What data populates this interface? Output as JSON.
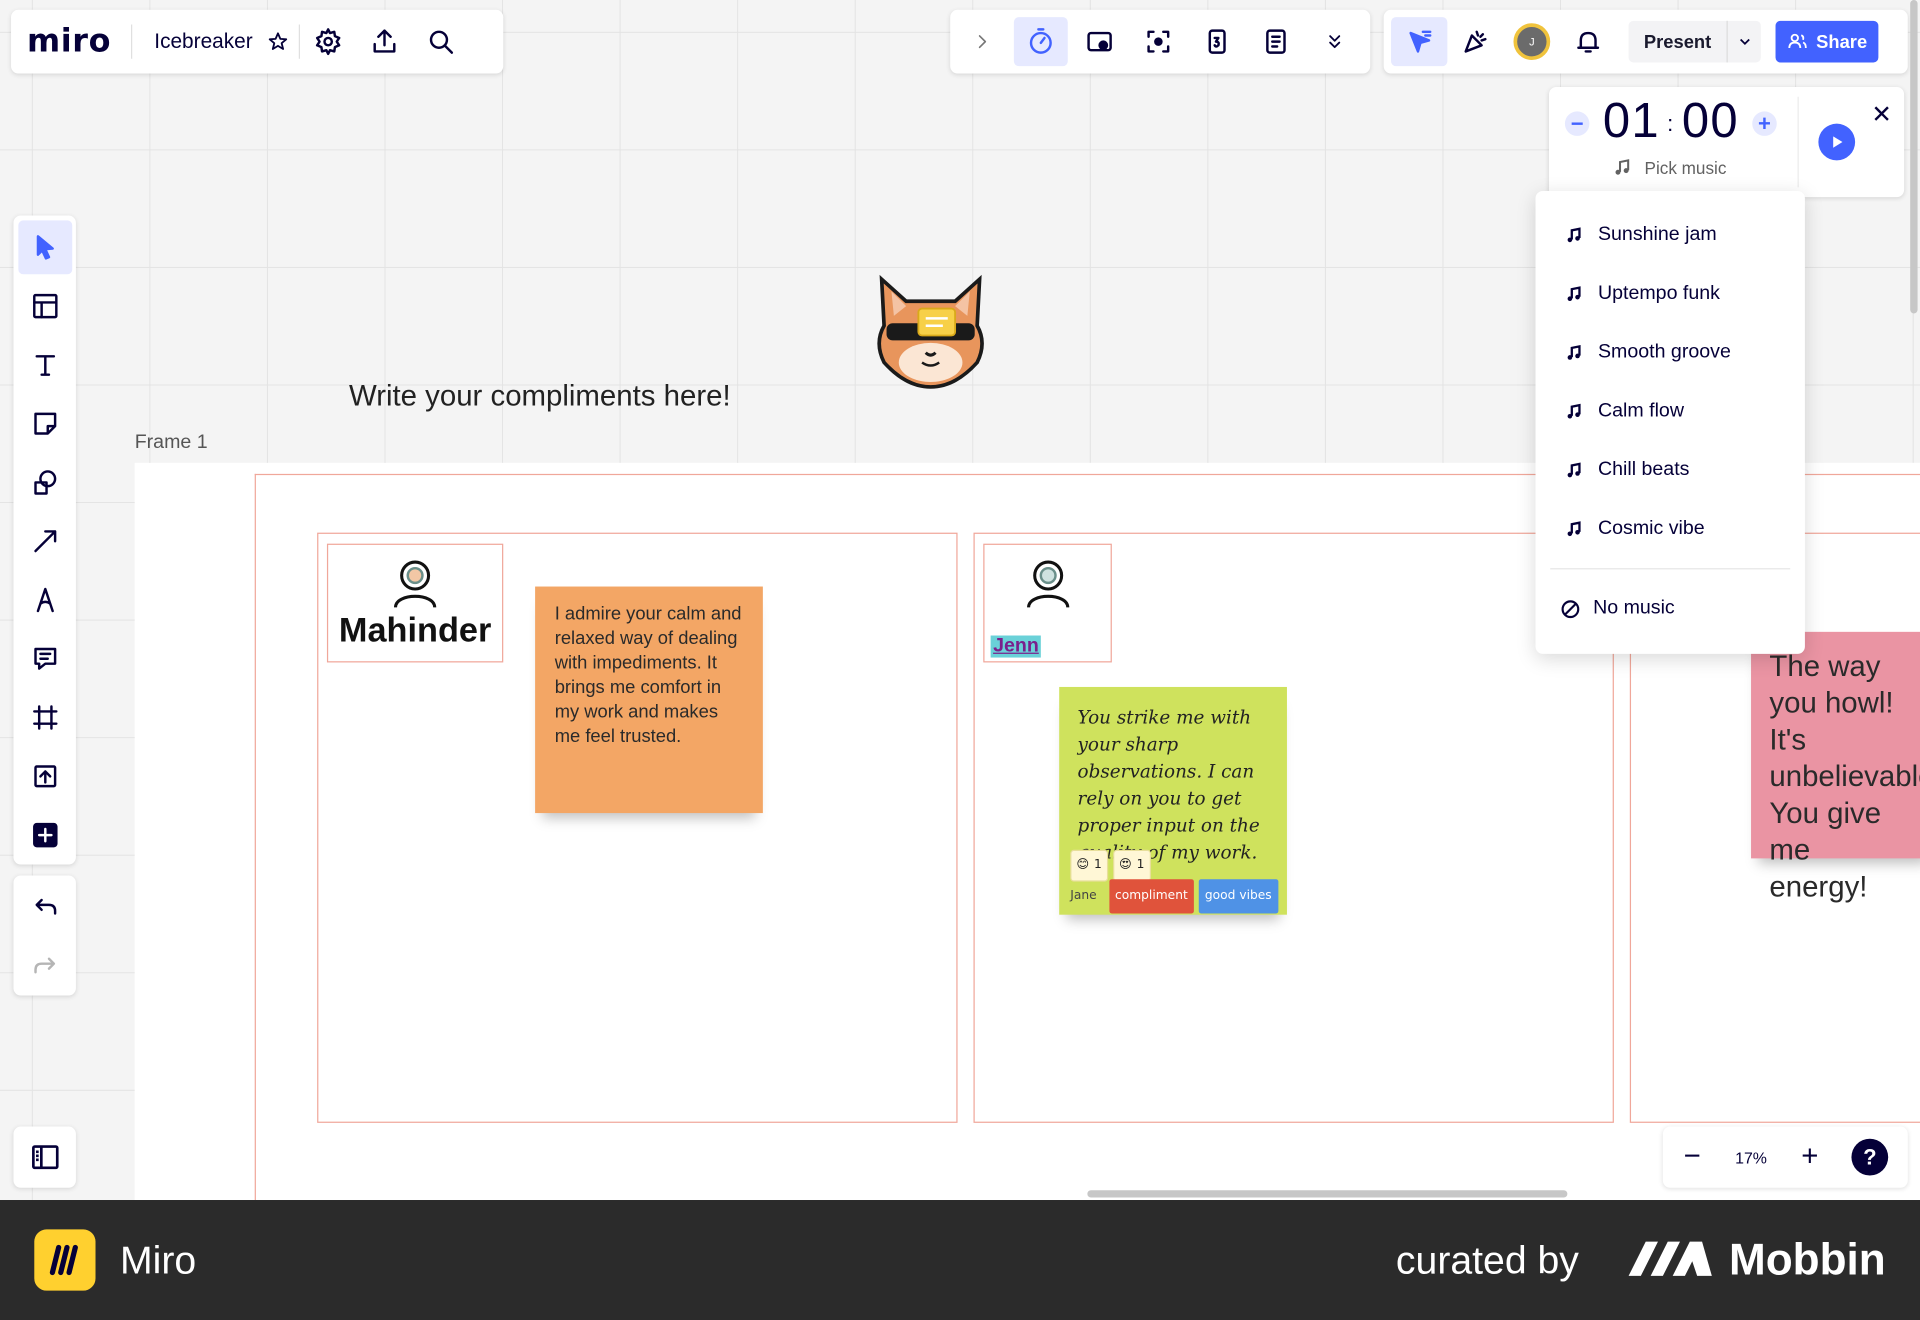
{
  "app": {
    "logo": "miro",
    "board_name": "Icebreaker"
  },
  "toolbar_right": {
    "avatar_initial": "J",
    "present_label": "Present",
    "share_label": "Share"
  },
  "timer": {
    "minutes": "01",
    "seconds": "00",
    "separator": ":",
    "minus": "−",
    "plus": "+",
    "pick_music": "Pick music",
    "close": "✕"
  },
  "music_menu": {
    "items": [
      "Sunshine jam",
      "Uptempo funk",
      "Smooth groove",
      "Calm flow",
      "Chill beats",
      "Cosmic vibe"
    ],
    "none_label": "No music"
  },
  "canvas": {
    "heading": "Write your compliments here!",
    "frame_label": "Frame 1",
    "people": [
      "Mahinder",
      "Jenn"
    ],
    "stickies": {
      "orange": "I admire your calm and relaxed way of dealing with impediments. It brings me comfort in my work and makes me feel trusted.",
      "green": "You strike me with your sharp observations. I can rely on you to get proper input on the quality of my work.",
      "pink": "The way you howl! It's unbelievable! You give me energy!"
    },
    "reactions": [
      {
        "emoji": "😊",
        "count": "1"
      },
      {
        "emoji": "😍",
        "count": "1"
      }
    ],
    "author": "Jane",
    "tags": [
      {
        "label": "compliment",
        "color": "#e0533b"
      },
      {
        "label": "good vibes",
        "color": "#4f92e6"
      }
    ]
  },
  "zoom": {
    "minus": "−",
    "value": "17%",
    "plus": "+",
    "help": "?"
  },
  "footer": {
    "app_name": "Miro",
    "curated_by": "curated by",
    "brand": "Mobbin"
  },
  "colors": {
    "accent": "#4262ff",
    "frame_border": "#f0a79a",
    "sticky_orange": "#f3a665",
    "sticky_green": "#cfe25d",
    "sticky_pink": "#ea94a3"
  }
}
